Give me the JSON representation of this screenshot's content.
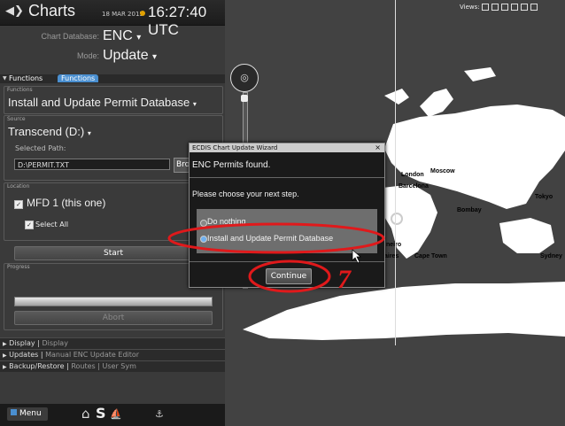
{
  "header": {
    "title": "Charts",
    "date": "18 MAR 2015",
    "time": "16:27:40 UTC"
  },
  "chart_database": {
    "label": "Chart Database:",
    "value": "ENC"
  },
  "mode": {
    "label": "Mode:",
    "value": "Update"
  },
  "functions_tabs": [
    "Functions",
    "Functions"
  ],
  "functions": {
    "group_label": "Functions",
    "selected": "Install and Update Permit Database"
  },
  "source": {
    "group_label": "Source",
    "selected": "Transcend (D:)",
    "path_label": "Selected Path:",
    "path_value": "D:\\PERMIT.TXT",
    "browse_label": "Browse"
  },
  "location": {
    "group_label": "Location",
    "item": "MFD 1 (this one)",
    "select_all": "Select All"
  },
  "start_label": "Start",
  "progress": {
    "label": "Progress",
    "abort_label": "Abort"
  },
  "sections": [
    {
      "label": "Display",
      "sub": "Display"
    },
    {
      "label": "Updates",
      "sub": "Manual ENC Update Editor"
    },
    {
      "label": "Backup/Restore",
      "sub": "Routes | User Sym"
    }
  ],
  "bottom": {
    "menu_label": "Menu",
    "s_label": "S"
  },
  "views_label": "Views:",
  "map_labels": [
    "London",
    "Moscow",
    "Barcelona",
    "Tokyo",
    "Bombay",
    "Cape Town",
    "Sydney",
    "aires",
    "neiro"
  ],
  "dialog": {
    "title": "ECDIS Chart Update Wizard",
    "close": "×",
    "message": "ENC Permits found.",
    "prompt": "Please choose your next step.",
    "options": [
      "Do nothing",
      "Install and Update Permit Database"
    ],
    "selected_option": 1,
    "continue_label": "Continue"
  },
  "annotation": {
    "step_number": "7",
    "color": "#e0191b"
  },
  "colors": {
    "tab_accent": "#4a8fd0",
    "panel": "#3a3a3a",
    "map_sea": "#424242",
    "map_land": "#ffffff"
  }
}
